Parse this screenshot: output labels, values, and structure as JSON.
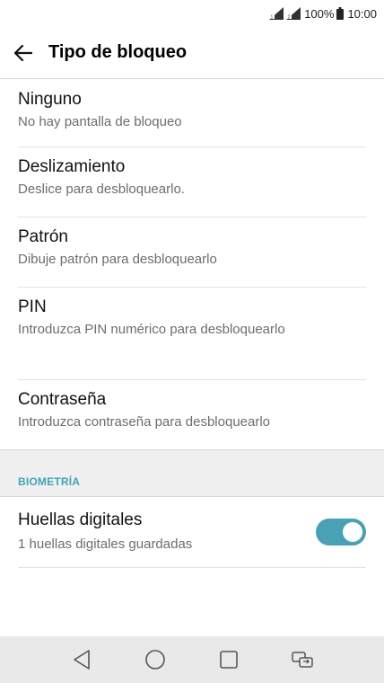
{
  "status_bar": {
    "battery_percent": "100%",
    "time": "10:00"
  },
  "app_bar": {
    "title": "Tipo de bloqueo"
  },
  "lock_options": [
    {
      "title": "Ninguno",
      "subtitle": "No hay pantalla de bloqueo"
    },
    {
      "title": "Deslizamiento",
      "subtitle": "Deslice para desbloquearlo."
    },
    {
      "title": "Patrón",
      "subtitle": "Dibuje patrón para desbloquearlo"
    },
    {
      "title": "PIN",
      "subtitle": "Introduzca PIN numérico para desbloquearlo"
    },
    {
      "title": "Contraseña",
      "subtitle": "Introduzca contraseña para desbloquearlo"
    }
  ],
  "biometrics": {
    "section_label": "BIOMETRÍA",
    "fingerprints": {
      "title": "Huellas digitales",
      "subtitle": "1 huellas digitales guardadas",
      "enabled": true
    }
  },
  "colors": {
    "accent": "#4aa0b4",
    "section_label": "#3fa4b9"
  },
  "nav_bar": {
    "icons": [
      "back-icon",
      "home-icon",
      "recents-icon",
      "dual-window-icon"
    ]
  }
}
